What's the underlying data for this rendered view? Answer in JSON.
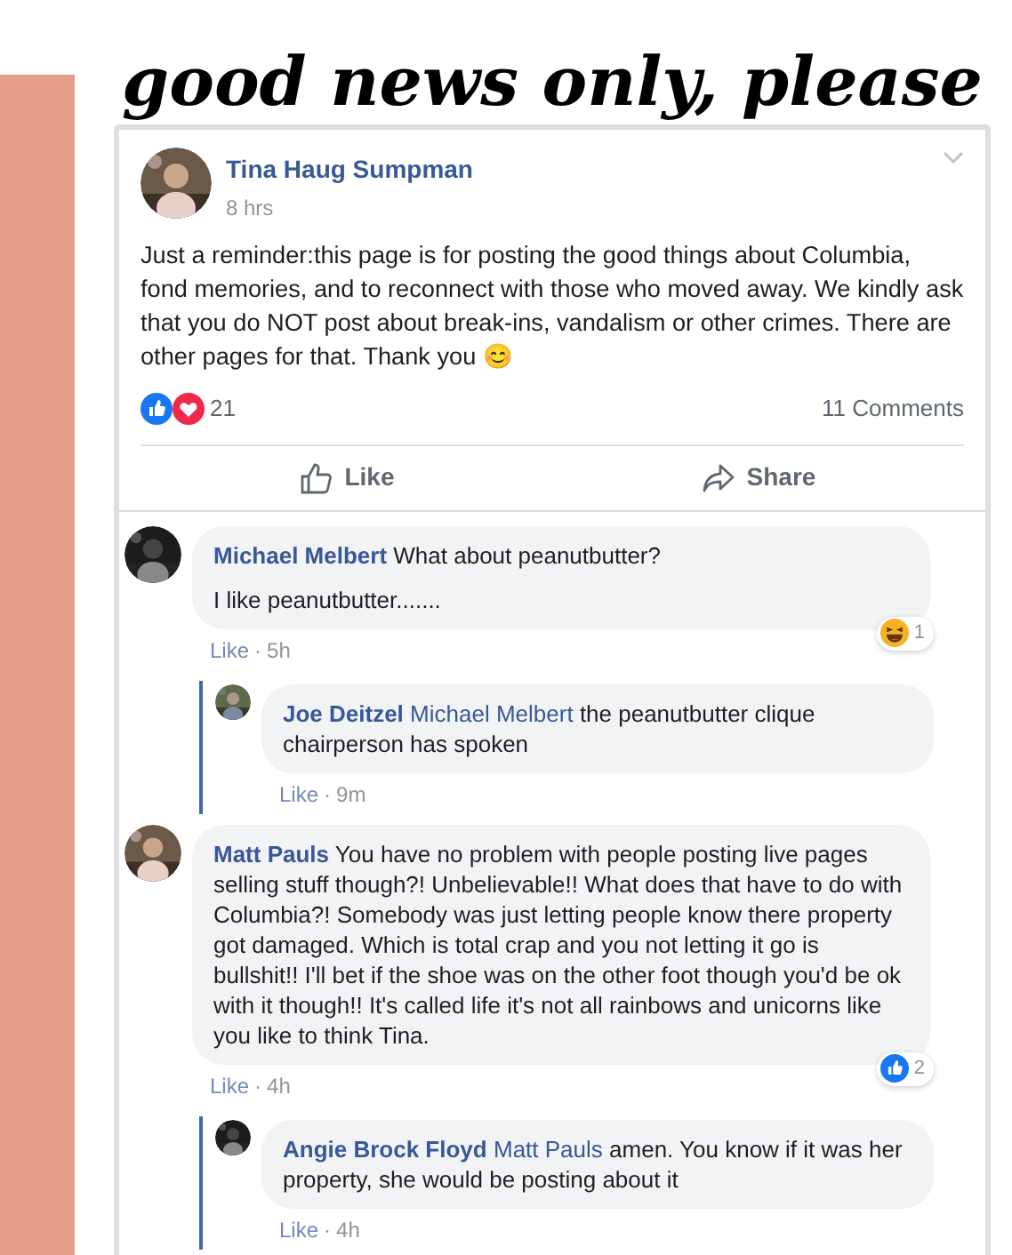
{
  "heading": "good news only, please",
  "post": {
    "author": "Tina Haug Sumpman",
    "time": "8 hrs",
    "text": "Just a reminder:this page is for posting the good things about Columbia, fond memories, and to reconnect with those who moved away. We kindly ask that you do NOT post about break-ins, vandalism or other crimes. There are other pages for that. Thank you 😊",
    "reactions": {
      "count": "21",
      "icons": [
        {
          "kind": "like"
        },
        {
          "kind": "love"
        }
      ]
    },
    "comments_count": "11 Comments",
    "actions": [
      {
        "kind": "like",
        "label": "Like"
      },
      {
        "kind": "share",
        "label": "Share"
      }
    ]
  },
  "comments": [
    {
      "author": "Michael Melbert",
      "text": "What about peanutbutter?",
      "extra": "I like peanutbutter.......",
      "like": "Like",
      "dot": "·",
      "time": "5h",
      "reaction": {
        "kind": "haha",
        "count": "1"
      },
      "replies": [
        {
          "author": "Joe Deitzel",
          "mention": "Michael Melbert",
          "text": "the peanutbutter clique chairperson has spoken",
          "like": "Like",
          "dot": "·",
          "time": "9m"
        }
      ]
    },
    {
      "author": "Matt Pauls",
      "text": "You have no problem with people posting live pages selling stuff though?! Unbelievable!! What does that have to do with Columbia?! Somebody was just letting people know there property got damaged. Which is total crap and you not letting it go is bullshit!! I'll bet if the shoe was on the other foot though you'd be ok with it though!! It's called life it's not all rainbows and unicorns like you like to think Tina.",
      "like": "Like",
      "dot": "·",
      "time": "4h",
      "reaction": {
        "kind": "like",
        "count": "2"
      },
      "replies": [
        {
          "author": "Angie Brock Floyd",
          "mention": "Matt Pauls",
          "text": "amen. You know if it was her property, she would be posting about it",
          "like": "Like",
          "dot": "·",
          "time": "4h"
        }
      ]
    }
  ]
}
